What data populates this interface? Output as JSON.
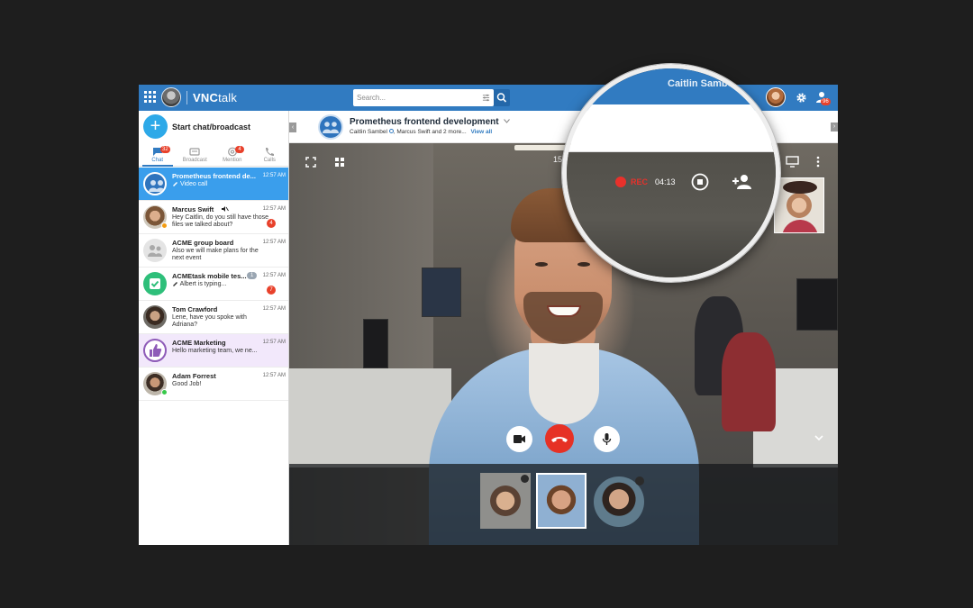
{
  "app": {
    "brand_bold": "VNC",
    "brand_light": "talk",
    "search_placeholder": "Search...",
    "top_user_name": "Caitlin Sambel",
    "contacts_badge": "96",
    "accent_color": "#317bc1"
  },
  "sidebar": {
    "start_chat_label": "Start chat/broadcast",
    "tabs": [
      {
        "label": "Chat",
        "icon": "chat-icon",
        "badge": "32"
      },
      {
        "label": "Broadcast",
        "icon": "broadcast-icon",
        "badge": ""
      },
      {
        "label": "Mention",
        "icon": "at-icon",
        "badge": "4"
      },
      {
        "label": "Calls",
        "icon": "phone-icon",
        "badge": ""
      }
    ],
    "chats": [
      {
        "name": "Prometheus frontend de...",
        "preview": "Video call",
        "time": "12:57 AM",
        "unread": "",
        "selected": true
      },
      {
        "name": "Marcus Swift",
        "preview": "Hey Caitlin, do you still have those files we talked about?",
        "time": "12:57 AM",
        "unread": "4",
        "muted": true
      },
      {
        "name": "ACME group board",
        "preview": "Also we will make plans for the next event",
        "time": "12:57 AM",
        "unread": ""
      },
      {
        "name": "ACMEtask mobile tes...",
        "preview": "Albert is typing...",
        "time": "12:57 AM",
        "unread": "7",
        "participants": "1"
      },
      {
        "name": "Tom Crawford",
        "preview": "Lene, have you spoke with Adriana?",
        "time": "12:57 AM",
        "unread": ""
      },
      {
        "name": "ACME Marketing",
        "preview": "Hello marketing team, we ne...",
        "time": "12:57 AM",
        "unread": ""
      },
      {
        "name": "Adam Forrest",
        "preview": "Good Job!",
        "time": "12:57 AM",
        "unread": ""
      }
    ]
  },
  "conversation": {
    "title": "Prometheus frontend development",
    "members": "Caitlin Sambel",
    "members_rest": ", Marcus Swift and 2 more...",
    "view_all": "View all"
  },
  "video": {
    "timer": "15",
    "rec_label": "REC",
    "rec_time": "04:13"
  }
}
